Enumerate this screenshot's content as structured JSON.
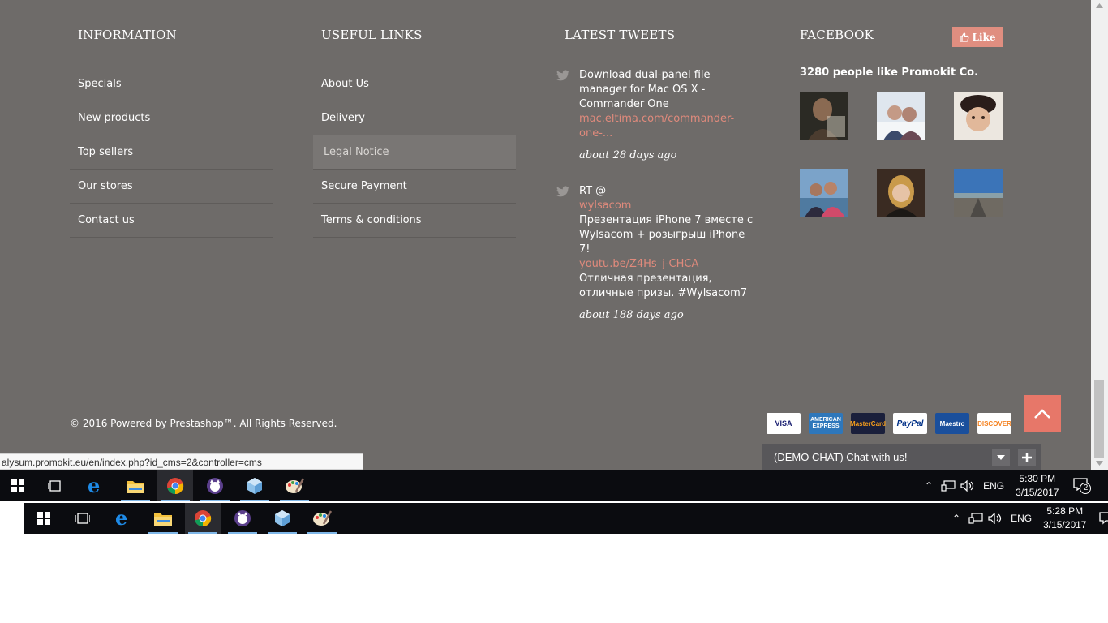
{
  "information": {
    "title": "INFORMATION",
    "items": [
      "Specials",
      "New products",
      "Top sellers",
      "Our stores",
      "Contact us"
    ]
  },
  "useful_links": {
    "title": "USEFUL LINKS",
    "items": [
      "About Us",
      "Delivery",
      "Legal Notice",
      "Secure Payment",
      "Terms & conditions"
    ],
    "hovered_index": 2
  },
  "tweets": {
    "title": "LATEST TWEETS",
    "items": [
      {
        "lines": [
          "Download dual-panel file manager for Mac OS X - Commander One"
        ],
        "link1": "mac.eltima.com/commander-one-...",
        "time": "about 28 days ago"
      },
      {
        "prefix": "RT @",
        "mention": "wylsacom",
        "text1": "Презентация iPhone 7 вместе с Wylsacom + розыгрыш iPhone 7!",
        "link": "youtu.be/Z4Hs_j-CHCA",
        "text2": "Отличная презентация, отличные призы. #Wylsacom7",
        "time": "about 188 days ago"
      }
    ]
  },
  "facebook": {
    "title": "FACEBOOK",
    "like_label": "Like",
    "count_text": "3280 people like Promokit Co."
  },
  "copyright": "© 2016 Powered by Prestashop™. All Rights Reserved.",
  "payments": [
    {
      "label": "VISA",
      "bg": "#ffffff",
      "fg": "#1a1f71"
    },
    {
      "label": "AMERICAN EXPRESS",
      "bg": "#2e77bb",
      "fg": "#ffffff"
    },
    {
      "label": "MasterCard",
      "bg": "#1a1f3b",
      "fg": "#f79e1b"
    },
    {
      "label": "PayPal",
      "bg": "#ffffff",
      "fg": "#003087"
    },
    {
      "label": "Maestro",
      "bg": "#1a4f9c",
      "fg": "#ffffff"
    },
    {
      "label": "DISCOVER",
      "bg": "#ffffff",
      "fg": "#f58220"
    }
  ],
  "chat": {
    "label": "(DEMO CHAT) Chat with us!"
  },
  "status_url": "alysum.promokit.eu/en/index.php?id_cms=2&controller=cms",
  "taskbar_top": {
    "lang": "ENG",
    "time": "5:30 PM",
    "date": "3/15/2017",
    "notifications": "2"
  },
  "taskbar_bottom": {
    "lang": "ENG",
    "time": "5:28 PM",
    "date": "3/15/2017"
  },
  "colors": {
    "footer_bg": "#6e6b69",
    "accent": "#e77769",
    "link": "#e08a7c"
  }
}
